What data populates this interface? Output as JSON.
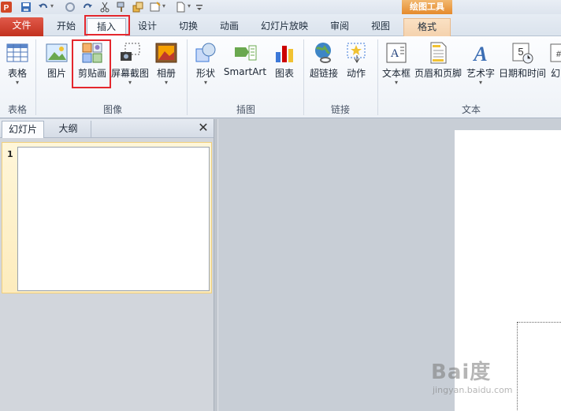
{
  "quick_access": {
    "icons": [
      "powerpoint-logo-icon",
      "save-icon",
      "undo-icon",
      "redo-icon",
      "repeat-icon",
      "cut-icon",
      "format-painter-icon",
      "shapes-icon",
      "new-slide-icon",
      "customize-qat-icon"
    ]
  },
  "contextual_tool": {
    "label": "绘图工具",
    "color": "#e58a2c"
  },
  "tabs": [
    {
      "label": "文件"
    },
    {
      "label": "开始"
    },
    {
      "label": "插入"
    },
    {
      "label": "设计"
    },
    {
      "label": "切换"
    },
    {
      "label": "动画"
    },
    {
      "label": "幻灯片放映"
    },
    {
      "label": "审阅"
    },
    {
      "label": "视图"
    },
    {
      "label": "格式"
    }
  ],
  "ribbon": {
    "groups": [
      {
        "label": "表格",
        "buttons": [
          {
            "label": "表格",
            "icon": "table-icon"
          }
        ]
      },
      {
        "label": "图像",
        "buttons": [
          {
            "label": "图片",
            "icon": "picture-icon"
          },
          {
            "label": "剪贴画",
            "icon": "clip-art-icon"
          },
          {
            "label": "屏幕截图",
            "icon": "screenshot-icon"
          },
          {
            "label": "相册",
            "icon": "photo-album-icon"
          }
        ]
      },
      {
        "label": "插图",
        "buttons": [
          {
            "label": "形状",
            "icon": "shapes-icon"
          },
          {
            "label": "SmartArt",
            "icon": "smartart-icon"
          },
          {
            "label": "图表",
            "icon": "chart-icon"
          }
        ]
      },
      {
        "label": "链接",
        "buttons": [
          {
            "label": "超链接",
            "icon": "hyperlink-icon"
          },
          {
            "label": "动作",
            "icon": "action-icon"
          }
        ]
      },
      {
        "label": "文本",
        "buttons": [
          {
            "label": "文本框",
            "icon": "text-box-icon"
          },
          {
            "label": "页眉和页脚",
            "icon": "header-footer-icon"
          },
          {
            "label": "艺术字",
            "icon": "wordart-icon"
          },
          {
            "label": "日期和时间",
            "icon": "date-time-icon"
          },
          {
            "label": "幻",
            "icon": "slide-number-icon"
          }
        ]
      }
    ]
  },
  "left_pane": {
    "tabs": [
      {
        "label": "幻灯片"
      },
      {
        "label": "大纲"
      }
    ],
    "slides": [
      {
        "number": "1"
      }
    ]
  },
  "highlight_color": "#e4272d",
  "watermark": {
    "logo": "Bai度",
    "sub": "jingyan.baidu.com"
  }
}
